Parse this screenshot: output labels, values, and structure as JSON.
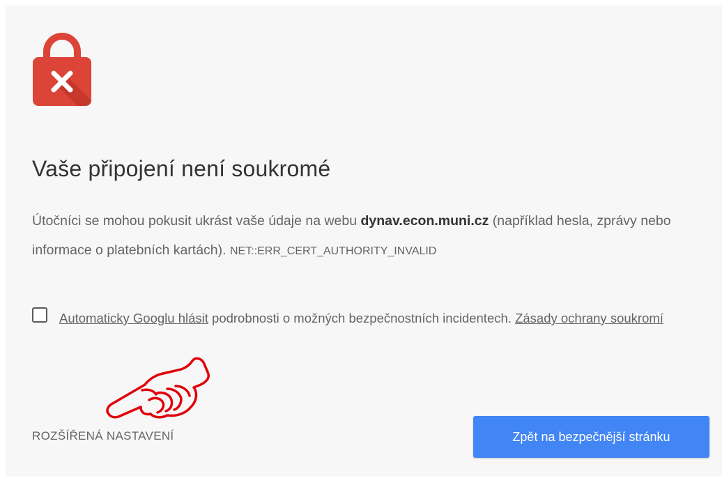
{
  "title": "Vaše připojení není soukromé",
  "description": {
    "text_before": "Útočníci se mohou pokusit ukrást vaše údaje na webu ",
    "domain": "dynav.econ.muni.cz",
    "text_after": " (například hesla, zprávy nebo informace o platebních kartách). ",
    "error_code": "NET::ERR_CERT_AUTHORITY_INVALID"
  },
  "report": {
    "link_label": "Automaticky Googlu hlásit",
    "text": " podrobnosti o možných bezpečnostních incidentech. ",
    "privacy_link": "Zásady ochrany soukromí",
    "checked": false
  },
  "advanced_label": "ROZŠÍŘENÁ NASTAVENÍ",
  "back_button_label": "Zpět na bezpečnější stránku",
  "colors": {
    "lock_red": "#db4437",
    "button_blue": "#4285f4",
    "annotation_red": "#e0000a"
  },
  "icons": [
    "lock-error-icon",
    "pointing-hand-icon",
    "checkbox-icon"
  ]
}
